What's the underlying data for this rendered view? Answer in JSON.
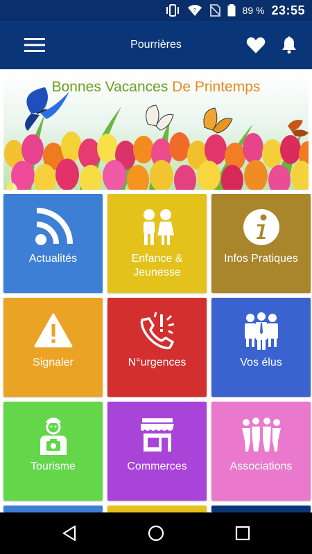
{
  "status_bar": {
    "time": "23:55",
    "battery_percent": "89 %",
    "icons": [
      "vibrate-icon",
      "wifi-icon",
      "no-sim-icon",
      "battery-icon"
    ]
  },
  "app_bar": {
    "title": "Pourrières",
    "icons": [
      "menu-icon",
      "heart-icon",
      "bell-icon"
    ]
  },
  "banner": {
    "text_part1": "Bonnes Vacances ",
    "text_part2": "De Printemps"
  },
  "tiles": [
    {
      "label": "Actualités",
      "icon": "rss-icon",
      "color": "#3d7fd4"
    },
    {
      "label": "Enfance & Jeunesse",
      "icon": "children-icon",
      "color": "#e3c21b"
    },
    {
      "label": "Infos Pratiques",
      "icon": "info-icon",
      "color": "#a9852c"
    },
    {
      "label": "Signaler",
      "icon": "warning-icon",
      "color": "#eba326"
    },
    {
      "label": "N°urgences",
      "icon": "emergency-phone-icon",
      "color": "#d32f2f"
    },
    {
      "label": "Vos élus",
      "icon": "people-icon",
      "color": "#3a63d0"
    },
    {
      "label": "Tourisme",
      "icon": "tourist-icon",
      "color": "#63d64a"
    },
    {
      "label": "Commerces",
      "icon": "shop-icon",
      "color": "#a944d9"
    },
    {
      "label": "Associations",
      "icon": "group-icon",
      "color": "#ea78cd"
    }
  ],
  "partial_tile_colors": [
    "#3d7fd4",
    "#e3c21b",
    "#0a3679"
  ],
  "nav_bar": {
    "icons": [
      "back-icon",
      "home-icon",
      "recents-icon"
    ]
  }
}
